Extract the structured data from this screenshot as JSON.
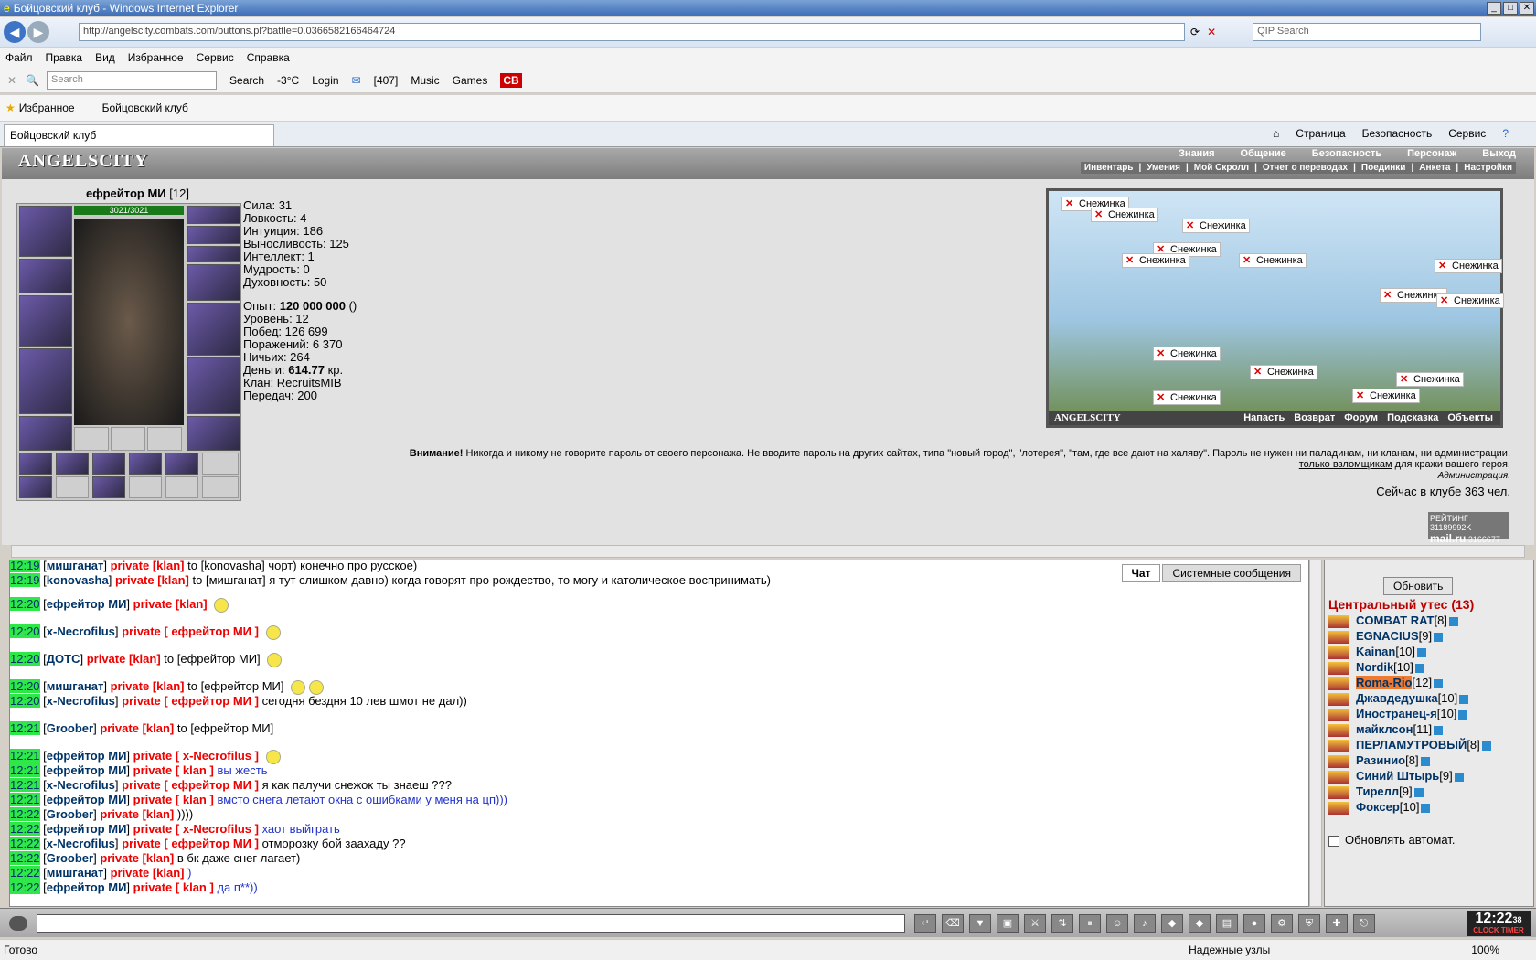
{
  "window": {
    "title": "Бойцовский клуб - Windows Internet Explorer"
  },
  "address": {
    "url": "http://angelscity.combats.com/buttons.pl?battle=0.0366582166464724",
    "search_placeholder": "QIP Search"
  },
  "menu": [
    "Файл",
    "Правка",
    "Вид",
    "Избранное",
    "Сервис",
    "Справка"
  ],
  "toolbar": {
    "search_placeholder": "Search",
    "search_btn": "Search",
    "weather": "-3°C",
    "login": "Login",
    "mail_count": "[407]",
    "music": "Music",
    "games": "Games"
  },
  "favorites": {
    "label": "Избранное",
    "link": "Бойцовский клуб"
  },
  "tab": {
    "label": "Бойцовский клуб"
  },
  "commands": [
    "Страница",
    "Безопасность",
    "Сервис"
  ],
  "game": {
    "logo": "ANGELSCITY",
    "mainnav": [
      "Знания",
      "Общение",
      "Безопасность",
      "Персонаж",
      "Выход"
    ],
    "subnav": [
      "Инвентарь",
      "Умения",
      "Мой Скролл",
      "Отчет о переводах",
      "Поединки",
      "Анкета",
      "Настройки"
    ],
    "character": {
      "name": "ефрейтор МИ",
      "level": "[12]",
      "hp": "3021/3021"
    },
    "stats": [
      "Сила: 31",
      "Ловкость: 4",
      "Интуиция: 186",
      "Выносливость: 125",
      "Интеллект: 1",
      "Мудрость: 0",
      "Духовность: 50"
    ],
    "stats2": {
      "exp_label": "Опыт: ",
      "exp": "120 000 000",
      "exp_suffix": " ()",
      "level": "Уровень: 12",
      "wins": "Побед: 126 699",
      "losses": "Поражений: 6 370",
      "draws": "Ничьих: 264",
      "money_label": "Деньги: ",
      "money": "614.77",
      "money_suffix": " кр.",
      "clan": "Клан: RecruitsMIB",
      "transfers": "Передач: 200"
    },
    "map": {
      "snow_label": "Снежинка",
      "footer_logo": "ANGELSCITY",
      "links": [
        "Напасть",
        "Возврат",
        "Форум",
        "Подсказка",
        "Объекты"
      ]
    },
    "warning": {
      "title": "Внимание!",
      "text": "Никогда и никому не говорите пароль от своего персонажа. Не вводите пароль на других сайтах, типа \"новый город\", \"лотерея\", \"там, где все дают на халяву\". Пароль не нужен ни паладинам, ни кланам, ни администрации,",
      "link": "только взломщикам",
      "tail": "для кражи вашего героя.",
      "signature": "Администрация."
    },
    "online": "Сейчас в клубе 363 чел.",
    "rating": {
      "label": "РЕЙТИНГ",
      "n1": "31189992K",
      "site": "mail.ru",
      "n2": "3166677",
      "n3": "14014"
    }
  },
  "chat": {
    "tabs": [
      "Чат",
      "Системные сообщения"
    ],
    "messages": [
      {
        "time": "12:19",
        "from": "мишганат",
        "to": "[klan]",
        "mid": "to [konovasha]",
        "text": "чорт) конечно про русское)"
      },
      {
        "time": "12:19",
        "from": "konovasha",
        "to": "[klan]",
        "mid": "to [мишганат]",
        "text": "я тут слишком давно) когда говорят про рождество, то могу и католическое воспринимать)"
      },
      {
        "time": "12:20",
        "from": "ефрейтор МИ",
        "to": "[klan]",
        "mid": "",
        "text": ""
      },
      {
        "time": "12:20",
        "from": "x-Necrofilus",
        "to": "[ ефрейтор МИ ]",
        "mid": "",
        "text": ""
      },
      {
        "time": "12:20",
        "from": "ДОТС",
        "to": "[klan]",
        "mid": "to [ефрейтор МИ]",
        "text": ""
      },
      {
        "time": "12:20",
        "from": "мишганат",
        "to": "[klan]",
        "mid": "to [ефрейтор МИ]",
        "text": ""
      },
      {
        "time": "12:20",
        "from": "x-Necrofilus",
        "to": "[ ефрейтор МИ ]",
        "mid": "",
        "text": "сегодня бездня 10 лев шмот не дал))"
      },
      {
        "time": "12:21",
        "from": "Groober",
        "to": "[klan]",
        "mid": "to [ефрейтор МИ]",
        "text": ""
      },
      {
        "time": "12:21",
        "from": "ефрейтор МИ",
        "to": "[ x-Necrofilus ]",
        "mid": "",
        "text": ""
      },
      {
        "time": "12:21",
        "from": "ефрейтор МИ",
        "to": "[ klan ]",
        "mid": "",
        "text": "вы жесть"
      },
      {
        "time": "12:21",
        "from": "x-Necrofilus",
        "to": "[ ефрейтор МИ ]",
        "mid": "",
        "text": "я как палучи снежок ты знаеш ???"
      },
      {
        "time": "12:21",
        "from": "ефрейтор МИ",
        "to": "[ klan ]",
        "mid": "",
        "text": "вмсто снега летают окна с ошибками у меня на цп)))"
      },
      {
        "time": "12:22",
        "from": "Groober",
        "to": "[klan]",
        "mid": "",
        "text": "))))"
      },
      {
        "time": "12:22",
        "from": "ефрейтор МИ",
        "to": "[ x-Necrofilus ]",
        "mid": "",
        "text": "хаот выйграть"
      },
      {
        "time": "12:22",
        "from": "x-Necrofilus",
        "to": "[ ефрейтор МИ ]",
        "mid": "",
        "text": "отморозку бой заахаду ??"
      },
      {
        "time": "12:22",
        "from": "Groober",
        "to": "[klan]",
        "mid": "",
        "text": "в бк даже снег лагает)"
      },
      {
        "time": "12:22",
        "from": "мишганат",
        "to": "[klan]",
        "mid": "",
        "text": ")"
      },
      {
        "time": "12:22",
        "from": "ефрейтор МИ",
        "to": "[ klan ]",
        "mid": "",
        "text": "да п**))"
      }
    ],
    "private_label": "private"
  },
  "room": {
    "refresh": "Обновить",
    "name": "Центральный утес (13)",
    "users": [
      {
        "name": "COMBAT RAT",
        "lvl": "[8]"
      },
      {
        "name": "EGNACIUS",
        "lvl": "[9]"
      },
      {
        "name": "Kainan",
        "lvl": "[10]"
      },
      {
        "name": "Nordik",
        "lvl": "[10]"
      },
      {
        "name": "Roma-Rio",
        "lvl": "[12]"
      },
      {
        "name": "Джавдедушка",
        "lvl": "[10]"
      },
      {
        "name": "Иностранец-я",
        "lvl": "[10]"
      },
      {
        "name": "майклсон",
        "lvl": "[11]"
      },
      {
        "name": "ПЕРЛАМУТРОВЫЙ",
        "lvl": "[8]"
      },
      {
        "name": "Разинио",
        "lvl": "[8]"
      },
      {
        "name": "Синий Штырь",
        "lvl": "[9]"
      },
      {
        "name": "Тирелл",
        "lvl": "[9]"
      },
      {
        "name": "Фоксер",
        "lvl": "[10]"
      }
    ],
    "auto": "Обновлять автомат."
  },
  "clock": {
    "time": "12:22",
    "sec": "38",
    "label": "CLOCK TIMER"
  },
  "status": {
    "left": "Готово",
    "zone": "Надежные узлы",
    "zoom": "100%"
  }
}
